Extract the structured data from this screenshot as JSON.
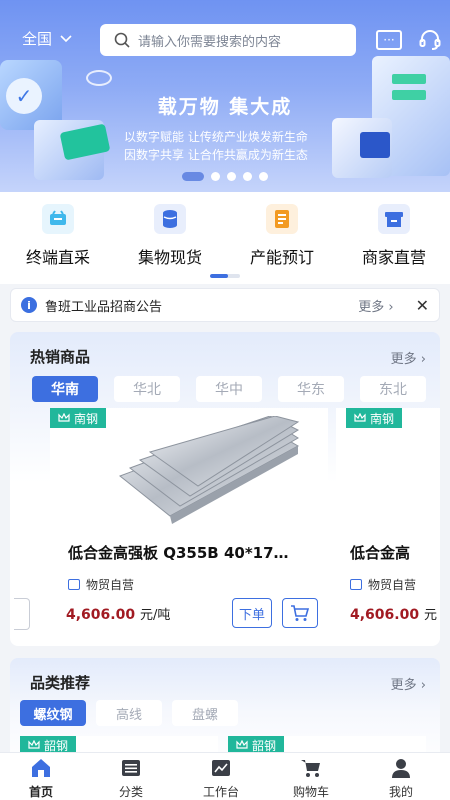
{
  "header": {
    "region_label": "全国",
    "search_placeholder": "请输入你需要搜索的内容"
  },
  "banner": {
    "title": "载万物 集大成",
    "subtitle_line1": "以数字赋能 让传统产业焕发新生命",
    "subtitle_line2": "因数字共享 让合作共赢成为新生态",
    "slide_count": 5,
    "active_slide": 0
  },
  "quick_nav": [
    {
      "label": "终端直采",
      "icon": "cart-icon",
      "color": "#3fb8ec"
    },
    {
      "label": "集物现货",
      "icon": "cylinder-stock-icon",
      "color": "#3d6fe0"
    },
    {
      "label": "产能预订",
      "icon": "document-order-icon",
      "color": "#f29a22"
    },
    {
      "label": "商家直营",
      "icon": "store-icon",
      "color": "#3d6fe0"
    }
  ],
  "notice": {
    "text": "鲁班工业品招商公告",
    "more_label": "更多"
  },
  "hot_products": {
    "title": "热销商品",
    "more_label": "更多",
    "tabs": [
      "华南",
      "华北",
      "华中",
      "华东",
      "东北"
    ],
    "active_tab": 0,
    "items": [
      {
        "tag": "南钢",
        "name": "低合金高强板 Q355B 40*17…",
        "shop": "物贸自营",
        "price": "4,606.00",
        "unit": "元/吨",
        "order_label": "下单"
      },
      {
        "tag": "南钢",
        "name": "低合金高",
        "shop": "物贸自营",
        "price": "4,606.00",
        "unit": "元"
      }
    ]
  },
  "category": {
    "title": "品类推荐",
    "more_label": "更多",
    "tabs": [
      "螺纹钢",
      "高线",
      "盘螺"
    ],
    "active_tab": 0,
    "tags": [
      "韶钢",
      "韶钢"
    ]
  },
  "bottom_nav": [
    {
      "label": "首页",
      "icon": "home-icon",
      "active": true
    },
    {
      "label": "分类",
      "icon": "category-list-icon",
      "active": false
    },
    {
      "label": "工作台",
      "icon": "workbench-chart-icon",
      "active": false
    },
    {
      "label": "购物车",
      "icon": "shopping-cart-icon",
      "active": false
    },
    {
      "label": "我的",
      "icon": "user-icon",
      "active": false
    }
  ],
  "colors": {
    "primary": "#3d6fe0",
    "price_red": "#a11a22",
    "tag_green": "#21b79b"
  }
}
